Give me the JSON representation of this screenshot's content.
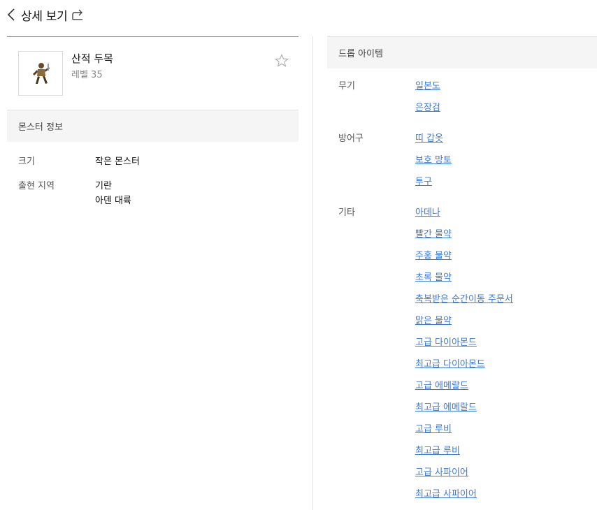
{
  "header": {
    "title": "상세 보기",
    "back_icon": "chevron-left-icon",
    "share_icon": "share-icon"
  },
  "monster": {
    "name": "산적 두목",
    "level": "레벨 35",
    "favorite_icon": "star-outline-icon"
  },
  "info_section": {
    "title": "몬스터 정보",
    "rows": [
      {
        "label": "크기",
        "values": [
          "작은 몬스터"
        ]
      },
      {
        "label": "출현 지역",
        "values": [
          "기란",
          "아덴 대륙"
        ]
      }
    ]
  },
  "drop_section": {
    "title": "드롭 아이템",
    "groups": [
      {
        "category": "무기",
        "items": [
          "일본도",
          "은장검"
        ]
      },
      {
        "category": "방어구",
        "items": [
          "띠 갑옷",
          "보호 망토",
          "투구"
        ]
      },
      {
        "category": "기타",
        "items": [
          "아데나",
          "빨간 물약",
          "주홍 물약",
          "초록 물약",
          "축복받은 순간이동 주문서",
          "맑은 물약",
          "고급 다이아몬드",
          "최고급 다이아몬드",
          "고급 에메랄드",
          "최고급 에메랄드",
          "고급 루비",
          "최고급 루비",
          "고급 사파이어",
          "최고급 사파이어"
        ]
      }
    ]
  },
  "colors": {
    "link": "#3a7bd5",
    "section_bg": "#f5f5f5",
    "divider": "#e2e2e2"
  }
}
